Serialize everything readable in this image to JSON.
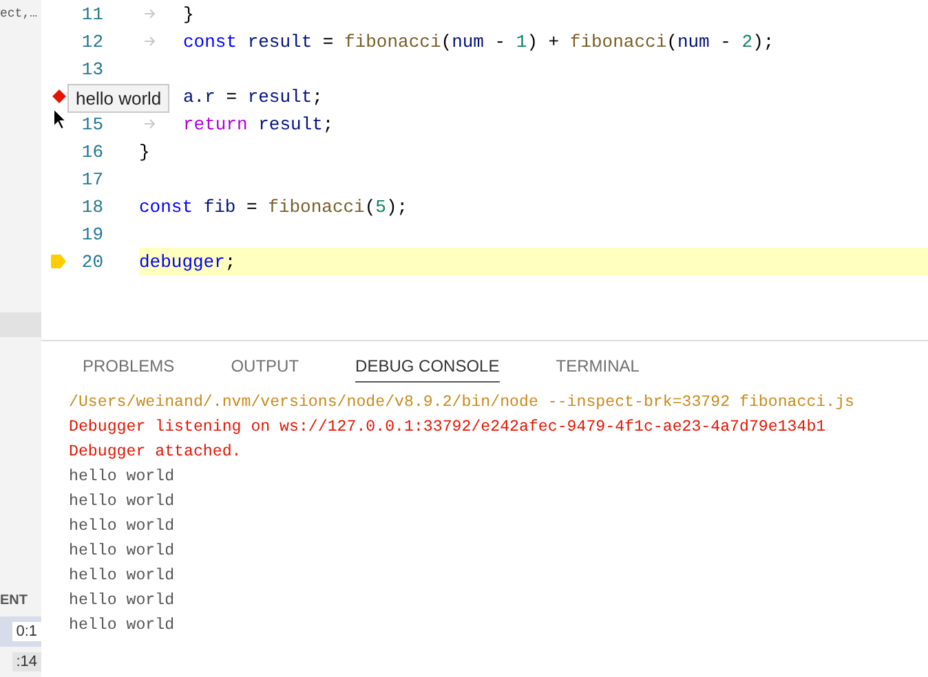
{
  "sidebar": {
    "top_text": "ect,…",
    "section_label": "ENT",
    "rows": [
      {
        "text": "0:1",
        "selected": true
      },
      {
        "text": ":14",
        "selected": false
      }
    ]
  },
  "editor": {
    "lines": [
      {
        "number": "11",
        "indent": true,
        "logpoint": false,
        "paused": false,
        "highlighted": false,
        "tokens": [
          {
            "kind": "punct",
            "text": "}"
          }
        ]
      },
      {
        "number": "12",
        "indent": true,
        "logpoint": false,
        "paused": false,
        "highlighted": false,
        "tokens": [
          {
            "kind": "keyword",
            "text": "const"
          },
          {
            "kind": "var",
            "text": " result"
          },
          {
            "kind": "punct",
            "text": " = "
          },
          {
            "kind": "func",
            "text": "fibonacci"
          },
          {
            "kind": "punct",
            "text": "("
          },
          {
            "kind": "var",
            "text": "num"
          },
          {
            "kind": "punct",
            "text": " - "
          },
          {
            "kind": "num",
            "text": "1"
          },
          {
            "kind": "punct",
            "text": ") + "
          },
          {
            "kind": "func",
            "text": "fibonacci"
          },
          {
            "kind": "punct",
            "text": "("
          },
          {
            "kind": "var",
            "text": "num"
          },
          {
            "kind": "punct",
            "text": " - "
          },
          {
            "kind": "num",
            "text": "2"
          },
          {
            "kind": "punct",
            "text": ");"
          }
        ]
      },
      {
        "number": "13",
        "indent": false,
        "logpoint": false,
        "paused": false,
        "highlighted": false
      },
      {
        "indent": true,
        "logpoint": true,
        "paused": false,
        "highlighted": false,
        "tokens": [
          {
            "kind": "var",
            "text": "a.r"
          },
          {
            "kind": "punct",
            "text": " = "
          },
          {
            "kind": "var",
            "text": "result"
          },
          {
            "kind": "punct",
            "text": ";"
          }
        ]
      },
      {
        "number": "15",
        "indent": true,
        "logpoint": false,
        "paused": false,
        "highlighted": false,
        "tokens": [
          {
            "kind": "control",
            "text": "return"
          },
          {
            "kind": "var",
            "text": " result"
          },
          {
            "kind": "punct",
            "text": ";"
          }
        ]
      },
      {
        "number": "16",
        "indent": false,
        "logpoint": false,
        "paused": false,
        "highlighted": false,
        "tokens": [
          {
            "kind": "punct",
            "text": "}"
          }
        ]
      },
      {
        "number": "17",
        "indent": false,
        "logpoint": false,
        "paused": false,
        "highlighted": false
      },
      {
        "number": "18",
        "indent": false,
        "logpoint": false,
        "paused": false,
        "highlighted": false,
        "tokens": [
          {
            "kind": "keyword",
            "text": "const"
          },
          {
            "kind": "var",
            "text": " fib"
          },
          {
            "kind": "punct",
            "text": " = "
          },
          {
            "kind": "func",
            "text": "fibonacci"
          },
          {
            "kind": "punct",
            "text": "("
          },
          {
            "kind": "num",
            "text": "5"
          },
          {
            "kind": "punct",
            "text": ");"
          }
        ]
      },
      {
        "number": "19",
        "indent": false,
        "logpoint": false,
        "paused": false,
        "highlighted": false
      },
      {
        "number": "20",
        "indent": false,
        "logpoint": false,
        "paused": true,
        "highlighted": true,
        "tokens": [
          {
            "kind": "keyword",
            "text": "debugger"
          },
          {
            "kind": "punct",
            "text": ";"
          }
        ]
      }
    ],
    "tooltip": "hello world"
  },
  "panel": {
    "tabs": [
      {
        "label": "PROBLEMS",
        "selected": false
      },
      {
        "label": "OUTPUT",
        "selected": false
      },
      {
        "label": "DEBUG CONSOLE",
        "selected": true
      },
      {
        "label": "TERMINAL",
        "selected": false
      }
    ],
    "console": [
      {
        "kind": "command",
        "text": "/Users/weinand/.nvm/versions/node/v8.9.2/bin/node --inspect-brk=33792 fibonacci.js"
      },
      {
        "kind": "error",
        "text": "Debugger listening on ws://127.0.0.1:33792/e242afec-9479-4f1c-ae23-4a7d79e134b1"
      },
      {
        "kind": "error",
        "text": "Debugger attached."
      },
      {
        "kind": "log",
        "text": "hello world"
      },
      {
        "kind": "log",
        "text": "hello world"
      },
      {
        "kind": "log",
        "text": "hello world"
      },
      {
        "kind": "log",
        "text": "hello world"
      },
      {
        "kind": "log",
        "text": "hello world"
      },
      {
        "kind": "log",
        "text": "hello world"
      },
      {
        "kind": "log",
        "text": "hello world"
      }
    ]
  }
}
